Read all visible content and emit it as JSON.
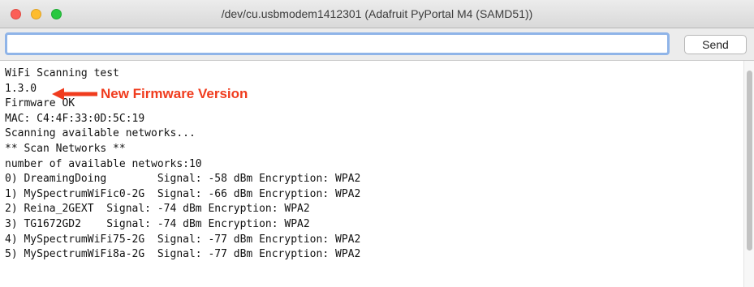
{
  "window": {
    "title": "/dev/cu.usbmodem1412301 (Adafruit PyPortal M4 (SAMD51))"
  },
  "input": {
    "value": "",
    "send_label": "Send"
  },
  "output": {
    "lines": [
      "WiFi Scanning test",
      "1.3.0",
      "Firmware OK",
      "MAC: C4:4F:33:0D:5C:19",
      "Scanning available networks...",
      "** Scan Networks **",
      "number of available networks:10",
      "0) DreamingDoing        Signal: -58 dBm Encryption: WPA2",
      "1) MySpectrumWiFic0-2G  Signal: -66 dBm Encryption: WPA2",
      "2) Reina_2GEXT  Signal: -74 dBm Encryption: WPA2",
      "3) TG1672GD2    Signal: -74 dBm Encryption: WPA2",
      "4) MySpectrumWiFi75-2G  Signal: -77 dBm Encryption: WPA2",
      "5) MySpectrumWiFi8a-2G  Signal: -77 dBm Encryption: WPA2"
    ]
  },
  "annotation": {
    "text": "New Firmware Version",
    "color": "#f03c1e",
    "icon": "left-arrow-icon"
  },
  "colors": {
    "close": "#fc5f57",
    "minimize": "#fdbc2e",
    "zoom": "#29c840",
    "focus_ring": "#8fb4e8"
  }
}
